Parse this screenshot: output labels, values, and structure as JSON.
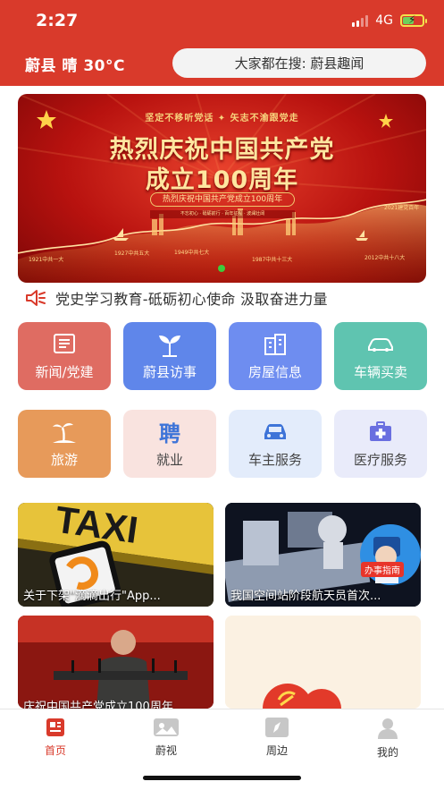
{
  "status_bar": {
    "time": "2:27",
    "network": "4G"
  },
  "header": {
    "weather": "蔚县 晴 30°C",
    "search_text": "大家都在搜: 蔚县趣闻"
  },
  "banner": {
    "motto": "坚定不移听党话 ✦ 矢志不渝跟党走",
    "title_line1": "热烈庆祝中国共产党",
    "title_line2": "成立100周年",
    "subtitle": "热烈庆祝中国共产党成立100周年",
    "strip": "不忘初心 · 砥砺前行 · 百年征程 · 波澜壮阔",
    "years": [
      "1921中共一大",
      "1927中共五大",
      "1949中共七大",
      "1987中共十三大",
      "2012中共十八大",
      "2021建党百年"
    ],
    "colors": {
      "bg": "#b8120f",
      "gold": "#ffe6a0",
      "active_dot": "#3ccc3c"
    }
  },
  "notice": {
    "icon": "speaker-icon",
    "text": "党史学习教育-砥砺初心使命 汲取奋进力量"
  },
  "services": [
    {
      "label": "新闻/党建",
      "icon": "news-icon",
      "bg": "#df6c62",
      "fg": "#ffffff"
    },
    {
      "label": "蔚县访事",
      "icon": "sprout-icon",
      "bg": "#5f86ea",
      "fg": "#ffffff"
    },
    {
      "label": "房屋信息",
      "icon": "building-icon",
      "bg": "#6e8df0",
      "fg": "#ffffff"
    },
    {
      "label": "车辆买卖",
      "icon": "car-icon",
      "bg": "#5fc4b0",
      "fg": "#ffffff"
    },
    {
      "label": "旅游",
      "icon": "beach-icon",
      "bg": "#e79a5a",
      "fg": "#ffffff"
    },
    {
      "label": "就业",
      "icon": "hiring-icon",
      "glyph": "聘",
      "bg": "#f9e3df",
      "fg": "#444444",
      "accent": "#3e74d8"
    },
    {
      "label": "车主服务",
      "icon": "car-service-icon",
      "bg": "#e3ecfb",
      "fg": "#444444",
      "accent": "#3e74d8"
    },
    {
      "label": "医疗服务",
      "icon": "medical-kit-icon",
      "bg": "#e9ebfa",
      "fg": "#444444",
      "accent": "#6a6fe0"
    }
  ],
  "news": [
    {
      "caption": "关于下架\"滴滴出行\"App..."
    },
    {
      "caption": "我国空间站阶段航天员首次..."
    },
    {
      "caption": "庆祝中国共产党成立100周年..."
    },
    {
      "caption": ""
    }
  ],
  "news_overlay": {
    "badge": "办事指南"
  },
  "tabbar": [
    {
      "label": "首页",
      "icon": "home-news-icon",
      "active": true
    },
    {
      "label": "蔚视",
      "icon": "video-icon",
      "active": false
    },
    {
      "label": "周边",
      "icon": "compass-icon",
      "active": false
    },
    {
      "label": "我的",
      "icon": "profile-icon",
      "active": false
    }
  ],
  "theme": {
    "primary": "#d93a2b",
    "text": "#333333"
  }
}
